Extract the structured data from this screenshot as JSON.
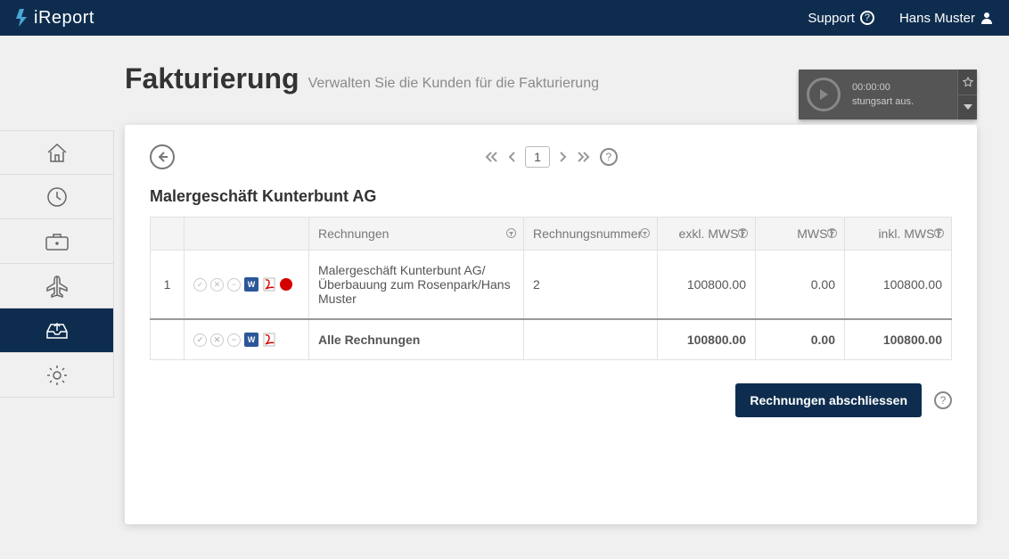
{
  "topbar": {
    "brand": "iReport",
    "support": "Support",
    "user": "Hans Muster"
  },
  "page": {
    "title": "Fakturierung",
    "subtitle": "Verwalten Sie die Kunden für die Fakturierung"
  },
  "timer": {
    "time": "00:00:00",
    "subtitle": "stungsart aus."
  },
  "pager": {
    "page": "1"
  },
  "company": "Malergeschäft Kunterbunt AG",
  "columns": {
    "rechnungen": "Rechnungen",
    "nummer": "Rechnungsnummer",
    "exkl": "exkl. MWST",
    "mwst": "MWST",
    "inkl": "inkl. MWST"
  },
  "rows": [
    {
      "idx": "1",
      "desc": "Malergeschäft Kunterbunt AG/Überbauung zum Rosenpark/Hans Muster",
      "nummer": "2",
      "exkl": "100800.00",
      "mwst": "0.00",
      "inkl": "100800.00"
    }
  ],
  "total": {
    "label": "Alle Rechnungen",
    "exkl": "100800.00",
    "mwst": "0.00",
    "inkl": "100800.00"
  },
  "actions": {
    "close": "Rechnungen abschliessen"
  }
}
